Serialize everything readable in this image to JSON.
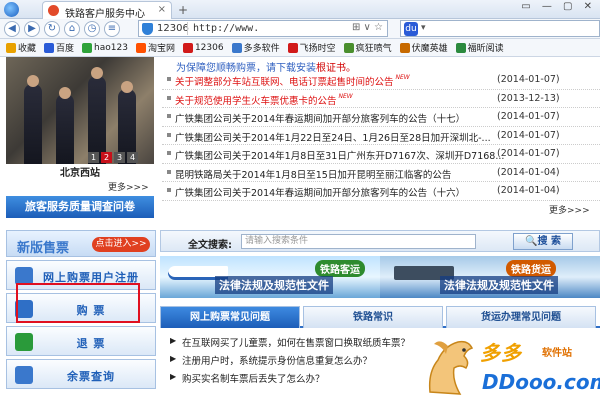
{
  "browser": {
    "tab_title": "铁路客户服务中心",
    "site_label": "12306",
    "url": "http://www.",
    "window_controls": "▭ — ▢ ✕"
  },
  "bookmarks": [
    {
      "label": "收藏",
      "color": "#e8a100"
    },
    {
      "label": "百度",
      "color": "#2a5bd7"
    },
    {
      "label": "hao123",
      "color": "#2fa33a"
    },
    {
      "label": "淘宝网",
      "color": "#ff5000"
    },
    {
      "label": "12306",
      "color": "#d11a1a"
    },
    {
      "label": "多多软件",
      "color": "#3a78cc"
    },
    {
      "label": "飞扬时空",
      "color": "#d11a1a"
    },
    {
      "label": "疯狂喷气",
      "color": "#4a8f2e"
    },
    {
      "label": "伏魔英雄",
      "color": "#c76a00"
    },
    {
      "label": "福昕阅读",
      "color": "#2b8a3e"
    }
  ],
  "photo": {
    "caption": "北京西站",
    "pages": [
      "1",
      "2",
      "3",
      "4"
    ],
    "more": "更多>>>"
  },
  "survey_banner": "旅客服务质量调查问卷",
  "news": {
    "notice": "为保障您顺畅购票，请下载安装",
    "notice_link": "根证书。",
    "items": [
      {
        "title": "关于调整部分车站互联网、电话订票起售时间的公告",
        "date": "",
        "red": true,
        "new": true
      },
      {
        "title": "关于规范使用学生火车票优惠卡的公告",
        "date": "",
        "red": true,
        "new": true
      },
      {
        "title": "广铁集团公司关于2014年春运期间加开部分旅客列车的公告（十七）",
        "date": "(2014-01-07)",
        "red": false,
        "new": false
      },
      {
        "title": "广铁集团公司关于2014年1月22日至24日、1月26日至28日加开深圳北-...",
        "date": "(2014-01-07)",
        "red": false,
        "new": false
      },
      {
        "title": "广铁集团公司关于2014年1月8日至31日广州东开D7167次、深圳开D7168...",
        "date": "(2014-01-07)",
        "red": false,
        "new": false
      },
      {
        "title": "昆明铁路局关于2014年1月8日至15日加开昆明至丽江临客的公告",
        "date": "(2014-01-04)",
        "red": false,
        "new": false
      },
      {
        "title": "广铁集团公司关于2014年春运期间加开部分旅客列车的公告（十六）",
        "date": "(2014-01-04)",
        "red": false,
        "new": false
      }
    ],
    "first_dates": [
      "(2014-01-07)",
      "(2013-12-13)"
    ],
    "more": "更多>>>",
    "new_tag": "NEW"
  },
  "ticket_section": {
    "heading": "新版售票",
    "enter_button": "点击进入>>",
    "items": [
      {
        "label": "网上购票用户注册",
        "icon": "user-register-icon",
        "color": "#3a78cc"
      },
      {
        "label": "购 票",
        "icon": "buy-ticket-icon",
        "color": "#2f6fc6"
      },
      {
        "label": "退 票",
        "icon": "refund-icon",
        "color": "#2a9a3a"
      },
      {
        "label": "余票查询",
        "icon": "remaining-ticket-icon",
        "color": "#3a78cc"
      }
    ]
  },
  "search": {
    "label": "全文搜索:",
    "placeholder": "请输入搜索条件",
    "button": "搜 索"
  },
  "banners": [
    {
      "tag": "铁路客运",
      "text": "法律法规及规范性文件"
    },
    {
      "tag": "铁路货运",
      "text": "法律法规及规范性文件"
    }
  ],
  "tabs": [
    "网上购票常见问题",
    "铁路常识",
    "货运办理常见问题"
  ],
  "faq": [
    "在互联网买了儿童票，如何在售票窗口换取纸质车票？",
    "注册用户时，系统提示身份信息重复怎么办？",
    "购买实名制车票后丢失了怎么办？"
  ],
  "watermark": {
    "brand": "多多",
    "sub": "软件站",
    "domain": "DDooo.com"
  }
}
